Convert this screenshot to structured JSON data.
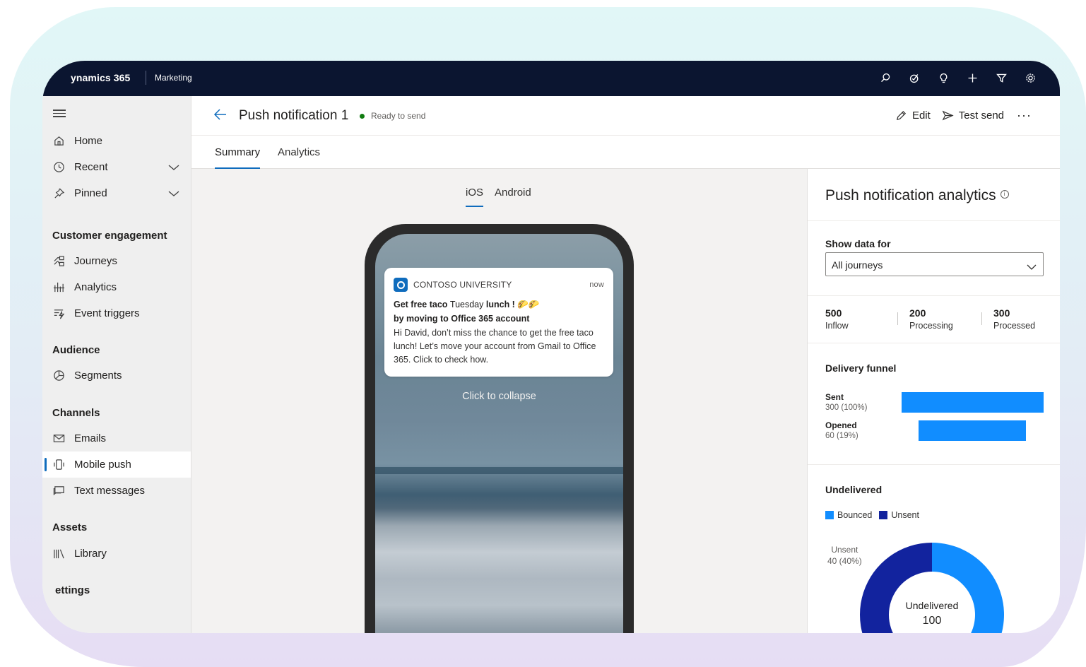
{
  "topbar": {
    "brand": "ynamics 365",
    "module": "Marketing",
    "icons": [
      "search-icon",
      "task-icon",
      "lightbulb-icon",
      "plus-icon",
      "filter-icon",
      "gear-icon"
    ]
  },
  "sidebar": {
    "items": [
      {
        "label": "Home",
        "icon": "home-icon"
      },
      {
        "label": "Recent",
        "icon": "clock-icon"
      },
      {
        "label": "Pinned",
        "icon": "pin-icon"
      }
    ],
    "groups": [
      {
        "title": "Customer engagement",
        "items": [
          {
            "label": "Journeys",
            "icon": "journeys-icon"
          },
          {
            "label": "Analytics",
            "icon": "analytics-icon"
          },
          {
            "label": "Event triggers",
            "icon": "event-triggers-icon"
          }
        ]
      },
      {
        "title": "Audience",
        "items": [
          {
            "label": "Segments",
            "icon": "segments-icon"
          }
        ]
      },
      {
        "title": "Channels",
        "items": [
          {
            "label": "Emails",
            "icon": "mail-icon"
          },
          {
            "label": "Mobile push",
            "icon": "mobile-icon"
          },
          {
            "label": "Text messages",
            "icon": "message-icon"
          }
        ]
      },
      {
        "title": "Assets",
        "items": [
          {
            "label": "Library",
            "icon": "library-icon"
          }
        ]
      }
    ],
    "settings_label": "ettings"
  },
  "header": {
    "title": "Push notification 1",
    "status": "Ready to send",
    "edit_label": "Edit",
    "test_send_label": "Test send",
    "more_label": "···"
  },
  "tabs": [
    "Summary",
    "Analytics"
  ],
  "preview": {
    "os_tabs": [
      "iOS",
      "Android"
    ],
    "notification": {
      "app_name": "CONTOSO UNIVERSITY",
      "time": "now",
      "line1_a": "Get free taco",
      "line1_b": "Tuesday",
      "line1_c": "lunch ! 🌮🌮",
      "line2": "by moving to Office 365 account",
      "body": "Hi David, don’t miss the chance to get the free taco lunch! Let’s move your account from Gmail to Office 365. Click to check how."
    },
    "collapse_text": "Click to collapse"
  },
  "analytics": {
    "title": "Push notification analytics",
    "show_data_label": "Show data for",
    "dropdown_value": "All journeys",
    "stats": [
      {
        "value": "500",
        "label": "Inflow"
      },
      {
        "value": "200",
        "label": "Processing"
      },
      {
        "value": "300",
        "label": "Processed"
      }
    ],
    "funnel_title": "Delivery funnel",
    "funnel": [
      {
        "name": "Sent",
        "value": "300 (100%)",
        "fraction": 1.0
      },
      {
        "name": "Opened",
        "value": "60 (19%)",
        "fraction": 0.76
      }
    ],
    "undelivered_title": "Undelivered",
    "legend": [
      {
        "name": "Bounced",
        "color": "#118dff"
      },
      {
        "name": "Unsent",
        "color": "#12239e"
      }
    ],
    "donut_label_name": "Unsent",
    "donut_label_value": "40 (40%)",
    "donut_center_title": "Undelivered",
    "donut_center_value": "100"
  },
  "chart_data": {
    "type": "pie",
    "title": "Undelivered",
    "categories": [
      "Bounced",
      "Unsent"
    ],
    "values": [
      60,
      40
    ]
  }
}
